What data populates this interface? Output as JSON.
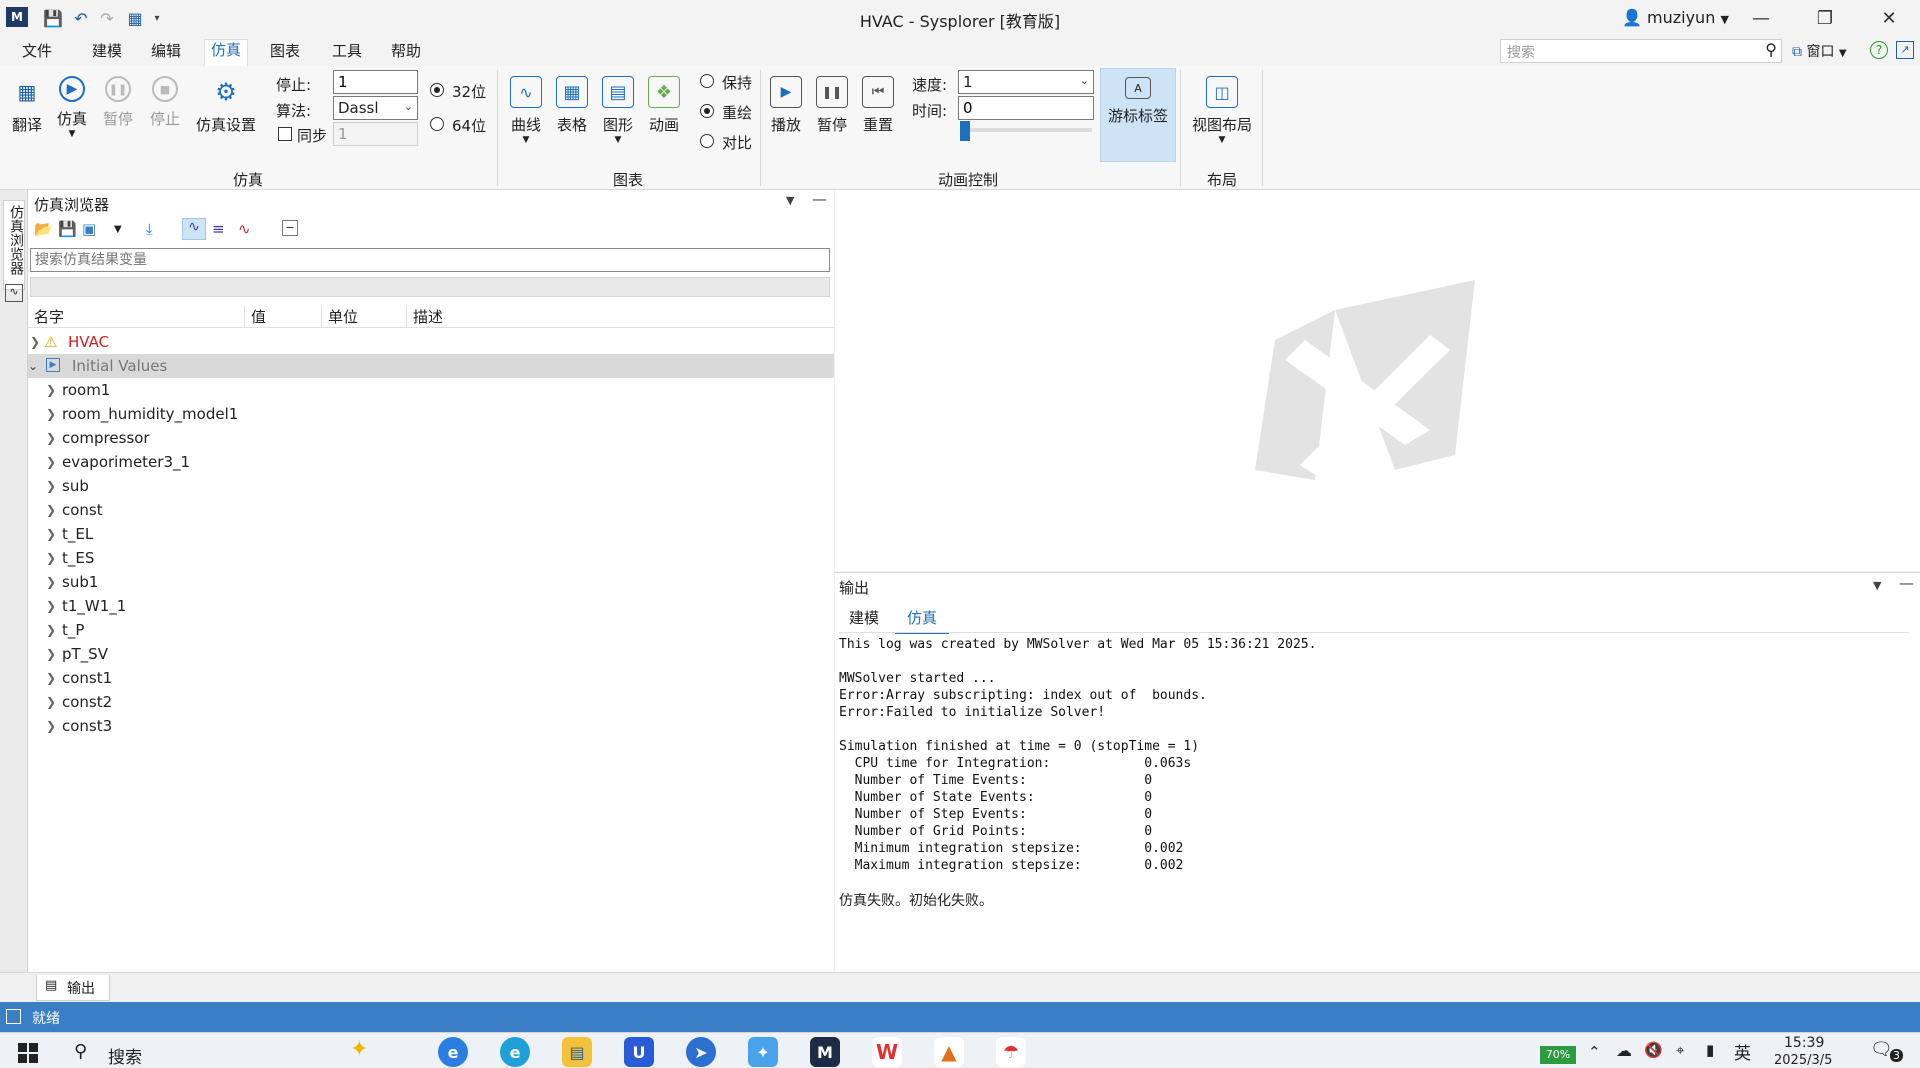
{
  "window": {
    "title": "HVAC - Sysplorer [教育版]",
    "user": "muziyun"
  },
  "menu": [
    "文件",
    "建模",
    "编辑",
    "仿真",
    "图表",
    "工具",
    "帮助"
  ],
  "search": {
    "placeholder": "搜索",
    "window_label": "窗口"
  },
  "ribbon": {
    "sim_buttons": [
      "翻译",
      "仿真",
      "暂停",
      "停止",
      "仿真设置"
    ],
    "stop_label": "停止:",
    "stop_value": "1",
    "algo_label": "算法:",
    "algo_value": "Dassl",
    "sync_label": "同步",
    "sync_value": "1",
    "bit32": "32位",
    "bit64": "64位",
    "group_sim": "仿真",
    "chart_buttons": [
      "曲线",
      "表格",
      "图形",
      "动画"
    ],
    "chart_radios": [
      "保持",
      "重绘",
      "对比"
    ],
    "group_chart": "图表",
    "anim_buttons": [
      "播放",
      "暂停",
      "重置"
    ],
    "speed_label": "速度:",
    "speed_value": "1",
    "time_label": "时间:",
    "time_value": "0",
    "cursor_label": "游标标签",
    "group_anim": "动画控制",
    "layout_button": "视图布局",
    "group_layout": "布局"
  },
  "vtab_label": "仿真浏览器",
  "browser": {
    "title": "仿真浏览器",
    "search_placeholder": "搜索仿真结果变量",
    "columns": [
      "名字",
      "值",
      "单位",
      "描述"
    ],
    "root": "HVAC",
    "initial": "Initial Values",
    "items": [
      "room1",
      "room_humidity_model1",
      "compressor",
      "evaporimeter3_1",
      "sub",
      "const",
      "t_EL",
      "t_ES",
      "sub1",
      "t1_W1_1",
      "t_P",
      "pT_SV",
      "const1",
      "const2",
      "const3"
    ]
  },
  "output": {
    "title": "输出",
    "tabs": [
      "建模",
      "仿真"
    ],
    "log": "This log was created by MWSolver at Wed Mar 05 15:36:21 2025.\n\nMWSolver started ...\nError:Array subscripting: index out of  bounds.\nError:Failed to initialize Solver!\n\nSimulation finished at time = 0 (stopTime = 1)\n  CPU time for Integration:            0.063s\n  Number of Time Events:               0\n  Number of State Events:              0\n  Number of Step Events:               0\n  Number of Grid Points:               0\n  Minimum integration stepsize:        0.002\n  Maximum integration stepsize:        0.002",
    "final": "仿真失败。初始化失败。"
  },
  "bottom_tab": "输出",
  "status": "就绪",
  "taskbar": {
    "search": "搜索",
    "battery": "70%",
    "lang": "英",
    "time": "15:39",
    "date": "2025/3/5",
    "notif": "3"
  },
  "colors": {
    "accent": "#1f6fbf",
    "status_bar": "#3a7fc6",
    "error_text": "#d42020",
    "selected_row": "#d9d9d9"
  }
}
